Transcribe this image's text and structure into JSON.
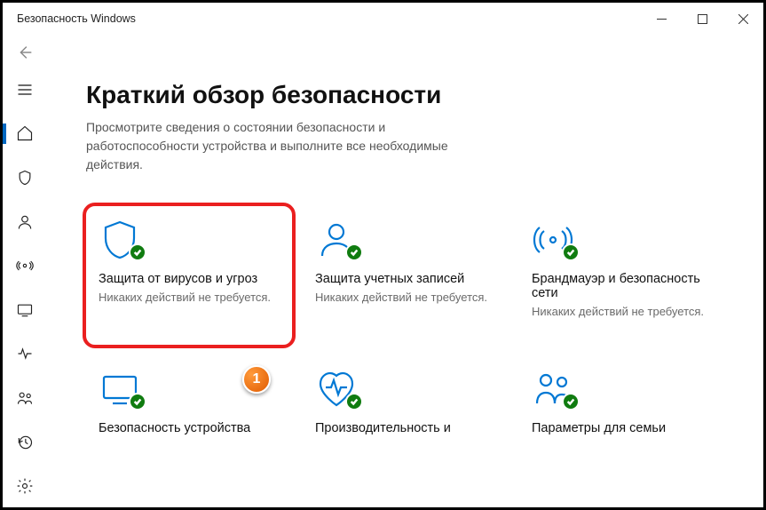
{
  "window": {
    "title": "Безопасность Windows"
  },
  "header": {
    "title": "Краткий обзор безопасности",
    "subtitle": "Просмотрите сведения о состоянии безопасности и работоспособности устройства и выполните все необходимые действия."
  },
  "cards": [
    {
      "title": "Защита от вирусов и угроз",
      "sub": "Никаких действий не требуется."
    },
    {
      "title": "Защита учетных записей",
      "sub": "Никаких действий не требуется."
    },
    {
      "title": "Брандмауэр и безопасность сети",
      "sub": "Никаких действий не требуется."
    },
    {
      "title": "Безопасность устройства",
      "sub": ""
    },
    {
      "title": "Производительность и",
      "sub": ""
    },
    {
      "title": "Параметры для семьи",
      "sub": ""
    }
  ],
  "annotation": {
    "label": "1"
  }
}
